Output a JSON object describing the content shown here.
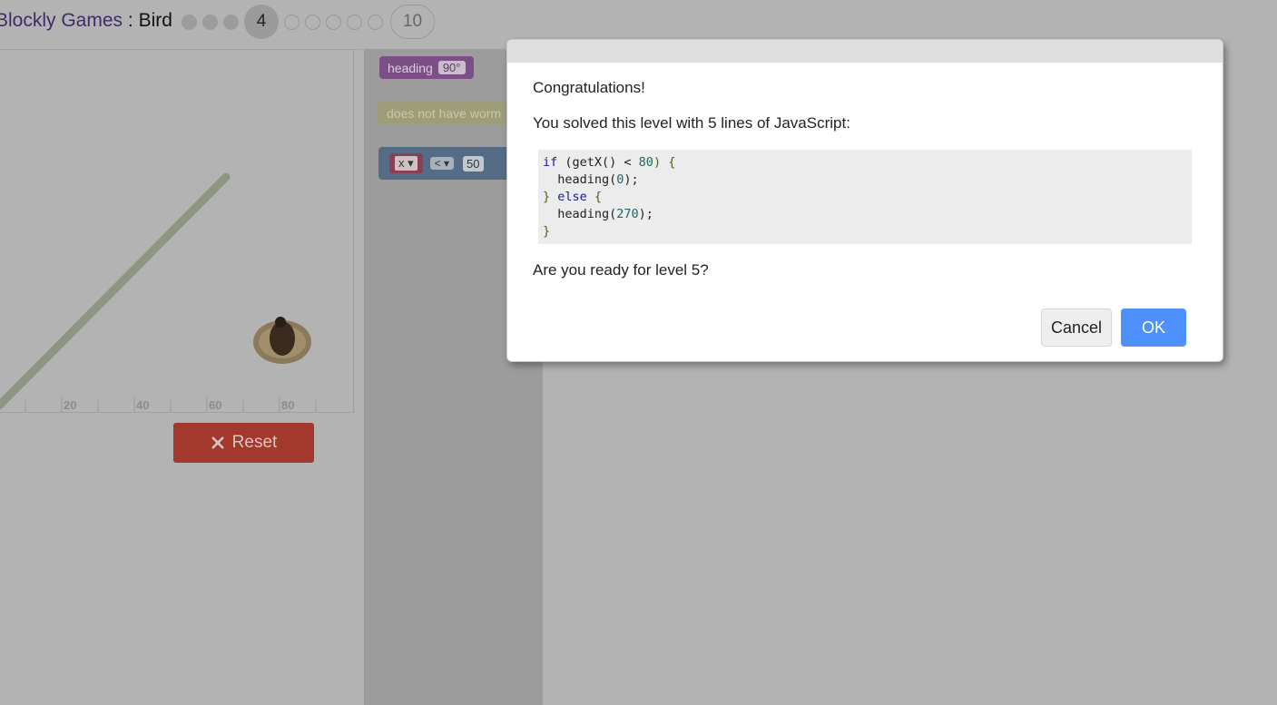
{
  "header": {
    "app_link": "Blockly Games",
    "separator": " : ",
    "game_name": "Bird",
    "levels": {
      "completed": 3,
      "current": "4",
      "remaining_dots": 5,
      "last": "10"
    }
  },
  "visualization": {
    "x_ticks": [
      "20",
      "40",
      "60",
      "80"
    ],
    "reset_label": "Reset"
  },
  "toolbox": {
    "heading_block_label": "heading",
    "heading_block_value": "90°",
    "worm_block_label": "does not have worm",
    "compare_var": "x",
    "compare_op": "<",
    "compare_value": "50"
  },
  "dialog": {
    "title_line": "Congratulations!",
    "summary": "You solved this level with 5 lines of JavaScript:",
    "code": {
      "line1_kw": "if",
      "line1_mid": " (getX() < ",
      "line1_num": "80",
      "line1_end": ") {",
      "line2_fn": "  heading(",
      "line2_num": "0",
      "line2_end": ");",
      "line3_open": "} ",
      "line3_kw": "else",
      "line3_end": " {",
      "line4_fn": "  heading(",
      "line4_num": "270",
      "line4_end": ");",
      "line5": "}"
    },
    "question": "Are you ready for level 5?",
    "cancel_label": "Cancel",
    "ok_label": "OK"
  },
  "colors": {
    "overlay_gray": "#b3b3b3",
    "ok_blue": "#4d90fe",
    "reset_red": "#a3382c"
  }
}
